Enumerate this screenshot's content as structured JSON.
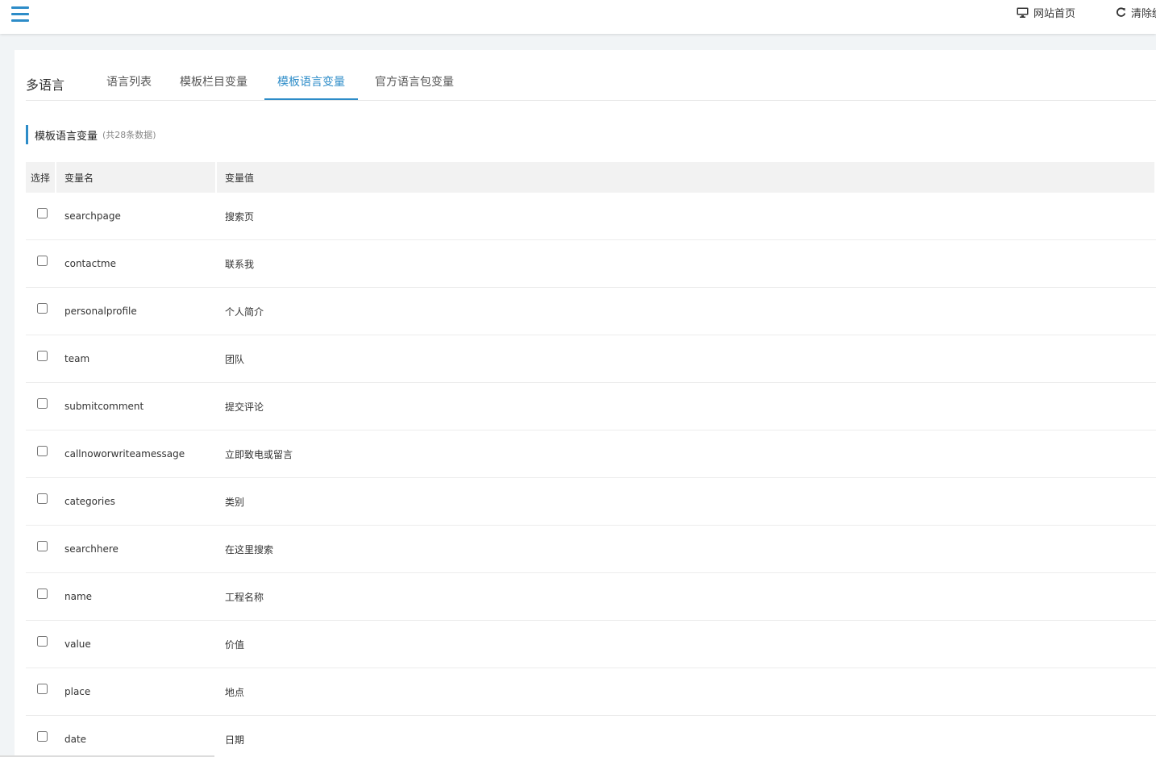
{
  "topbar": {
    "menu_icon": "hamburger-menu-icon",
    "website_home_label": "网站首页",
    "website_home_icon": "monitor-icon",
    "clear_cache_label": "清除缓存",
    "clear_cache_icon": "refresh-icon",
    "accent_color": "#2d8cc8"
  },
  "tabs": {
    "title": "多语言",
    "items": [
      {
        "label": "语言列表",
        "active": false
      },
      {
        "label": "模板栏目变量",
        "active": false
      },
      {
        "label": "模板语言变量",
        "active": true
      },
      {
        "label": "官方语言包变量",
        "active": false
      }
    ]
  },
  "section": {
    "title": "模板语言变量",
    "count_text": "(共28条数据)"
  },
  "table": {
    "headers": {
      "select": "选择",
      "name": "变量名",
      "value": "变量值"
    },
    "rows": [
      {
        "name": "searchpage",
        "value": "搜索页"
      },
      {
        "name": "contactme",
        "value": "联系我"
      },
      {
        "name": "personalprofile",
        "value": "个人简介"
      },
      {
        "name": "team",
        "value": "团队"
      },
      {
        "name": "submitcomment",
        "value": "提交评论"
      },
      {
        "name": "callnoworwriteamessage",
        "value": "立即致电或留言"
      },
      {
        "name": "categories",
        "value": "类别"
      },
      {
        "name": "searchhere",
        "value": "在这里搜索"
      },
      {
        "name": "name",
        "value": "工程名称"
      },
      {
        "name": "value",
        "value": "价值"
      },
      {
        "name": "place",
        "value": "地点"
      },
      {
        "name": "date",
        "value": "日期"
      }
    ]
  }
}
